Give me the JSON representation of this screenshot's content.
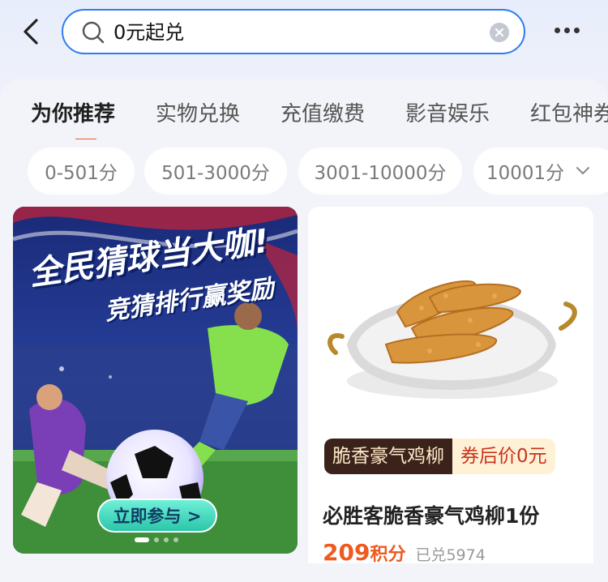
{
  "search": {
    "query": "0元起兑"
  },
  "tabs": [
    {
      "label": "为你推荐",
      "active": true
    },
    {
      "label": "实物兑换",
      "active": false
    },
    {
      "label": "充值缴费",
      "active": false
    },
    {
      "label": "影音娱乐",
      "active": false
    },
    {
      "label": "红包神券",
      "active": false
    }
  ],
  "filters": [
    {
      "label": "0-501分"
    },
    {
      "label": "501-3000分"
    },
    {
      "label": "3001-10000分"
    },
    {
      "label": "10001分"
    }
  ],
  "promo": {
    "title": "全民猜球当大咖!",
    "subtitle": "竞猜排行赢奖励",
    "button": "立即参与 >"
  },
  "product": {
    "badge_name": "脆香豪气鸡柳",
    "badge_price": "券后价0元",
    "name": "必胜客脆香豪气鸡柳1份",
    "points": "209",
    "points_unit": "积分",
    "sold": "已兑5974"
  },
  "colors": {
    "accent": "#e15b2b",
    "search_border": "#2f7cf0",
    "price": "#ef5a1f"
  },
  "icons": [
    "back-arrow-icon",
    "search-icon",
    "clear-icon",
    "more-icon",
    "chevron-down-icon"
  ]
}
